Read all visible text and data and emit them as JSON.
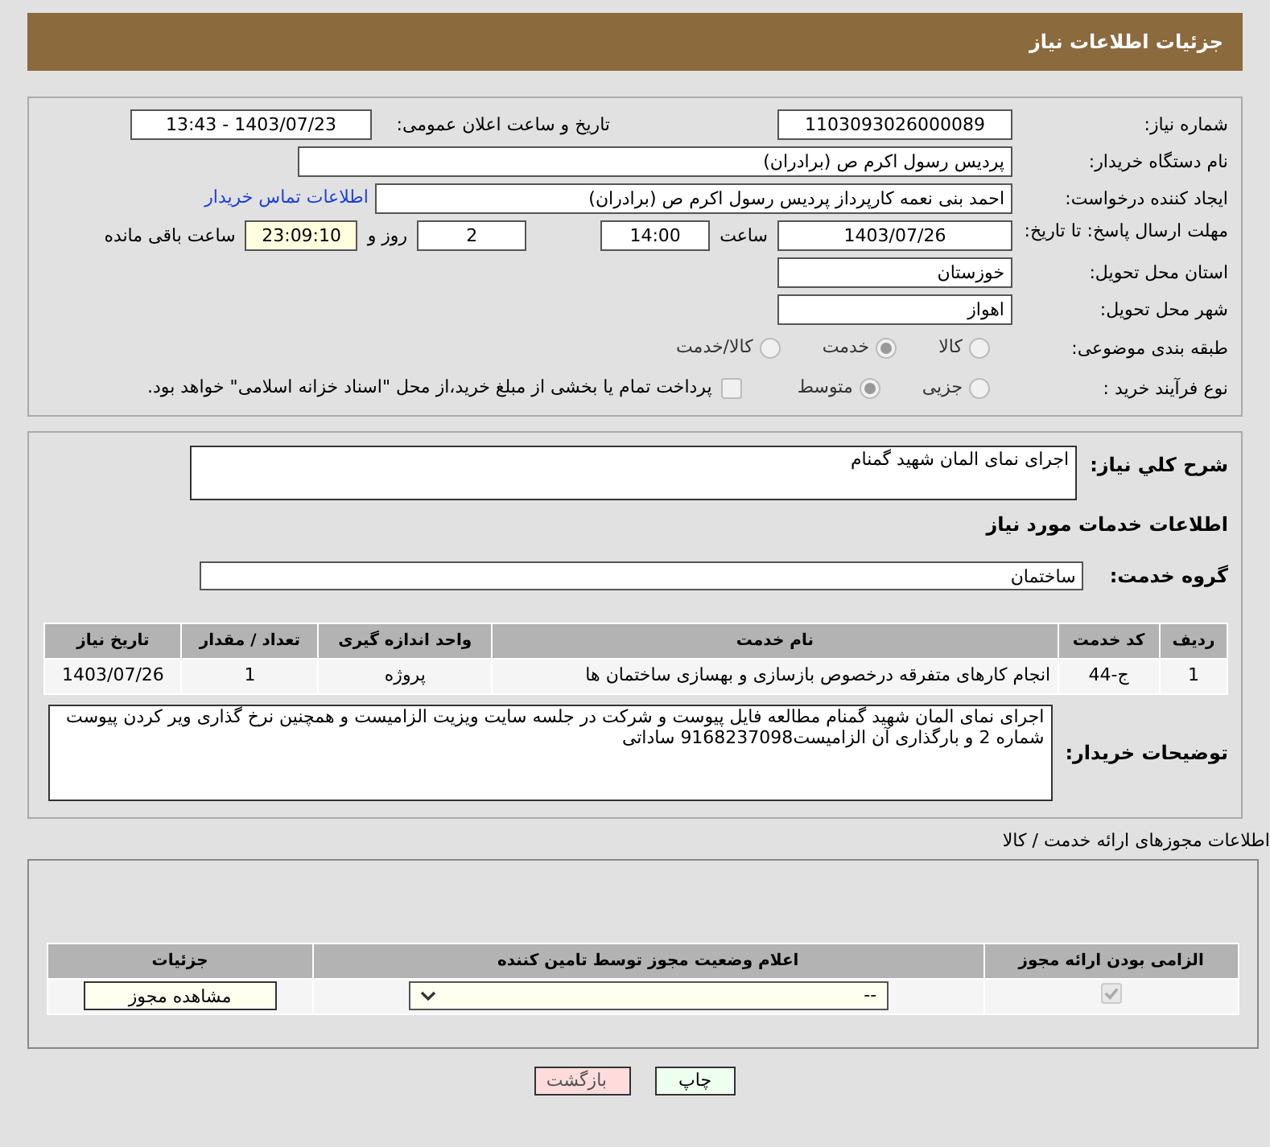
{
  "header": {
    "title": "جزئیات اطلاعات نیاز"
  },
  "general": {
    "need_number": {
      "label": "شماره نیاز:",
      "value": "1103093026000089"
    },
    "announce": {
      "label": "تاریخ و ساعت اعلان عمومی:",
      "value": "1403/07/23 - 13:43"
    },
    "buyer_org": {
      "label": "نام دستگاه خریدار:",
      "value": "پردیس رسول اکرم ص (برادران)"
    },
    "requester": {
      "label": "ایجاد کننده درخواست:",
      "value": "احمد بنی نعمه کارپرداز پردیس رسول اکرم ص (برادران)",
      "link": "اطلاعات تماس خریدار"
    },
    "deadline": {
      "label": "مهلت ارسال پاسخ: تا تاریخ:",
      "date": "1403/07/26",
      "time_label": "ساعت",
      "time": "14:00",
      "days": "2",
      "days_label": "روز و",
      "remaining": "23:09:10",
      "remaining_label": "ساعت باقی مانده"
    },
    "province": {
      "label": "استان محل تحویل:",
      "value": "خوزستان"
    },
    "city": {
      "label": "شهر محل تحویل:",
      "value": "اهواز"
    },
    "category": {
      "label": "طبقه بندی موضوعی:",
      "options": [
        {
          "label": "کالا",
          "selected": false
        },
        {
          "label": "خدمت",
          "selected": true
        },
        {
          "label": "کالا/خدمت",
          "selected": false
        }
      ]
    },
    "process": {
      "label": "نوع فرآیند خرید :",
      "options": [
        {
          "label": "جزیی",
          "selected": false
        },
        {
          "label": "متوسط",
          "selected": true
        }
      ],
      "payment": {
        "checked": false,
        "label": "پرداخت تمام یا بخشی از مبلغ خرید،از محل \"اسناد خزانه اسلامی\" خواهد بود."
      }
    }
  },
  "summary": {
    "label": "شرح کلي نیاز:",
    "value": "اجرای نمای المان شهید گمنام"
  },
  "services_title": "اطلاعات خدمات مورد نیاز",
  "service_group": {
    "label": "گروه خدمت:",
    "value": "ساختمان"
  },
  "services_table": {
    "columns": [
      "ردیف",
      "کد خدمت",
      "نام خدمت",
      "واحد اندازه گیری",
      "تعداد / مقدار",
      "تاریخ نیاز"
    ],
    "rows": [
      [
        "1",
        "ج-44",
        "انجام کارهای متفرقه درخصوص بازسازی و بهسازی ساختمان ها",
        "پروژه",
        "1",
        "1403/07/26"
      ]
    ]
  },
  "buyer_notes": {
    "label": "توضیحات خریدار:",
    "value": "اجرای نمای المان شهید گمنام مطالعه فایل پیوست و شرکت در جلسه سایت ویزیت الزامیست و همچنین نرخ گذاری ویر کردن پیوست شماره 2 و بارگذاری آن الزامیست9168237098 ساداتی"
  },
  "permits": {
    "title": "اطلاعات مجوزهای ارائه خدمت / کالا",
    "columns": [
      "الزامی بودن ارائه مجوز",
      "اعلام وضعیت مجوز توسط تامین کننده",
      "جزئیات"
    ],
    "rows": [
      {
        "required": true,
        "status": "--",
        "details": "مشاهده مجوز"
      }
    ]
  },
  "buttons": [
    {
      "label": "چاپ",
      "kind": "print"
    },
    {
      "label": "بازگشت",
      "kind": "back"
    }
  ]
}
